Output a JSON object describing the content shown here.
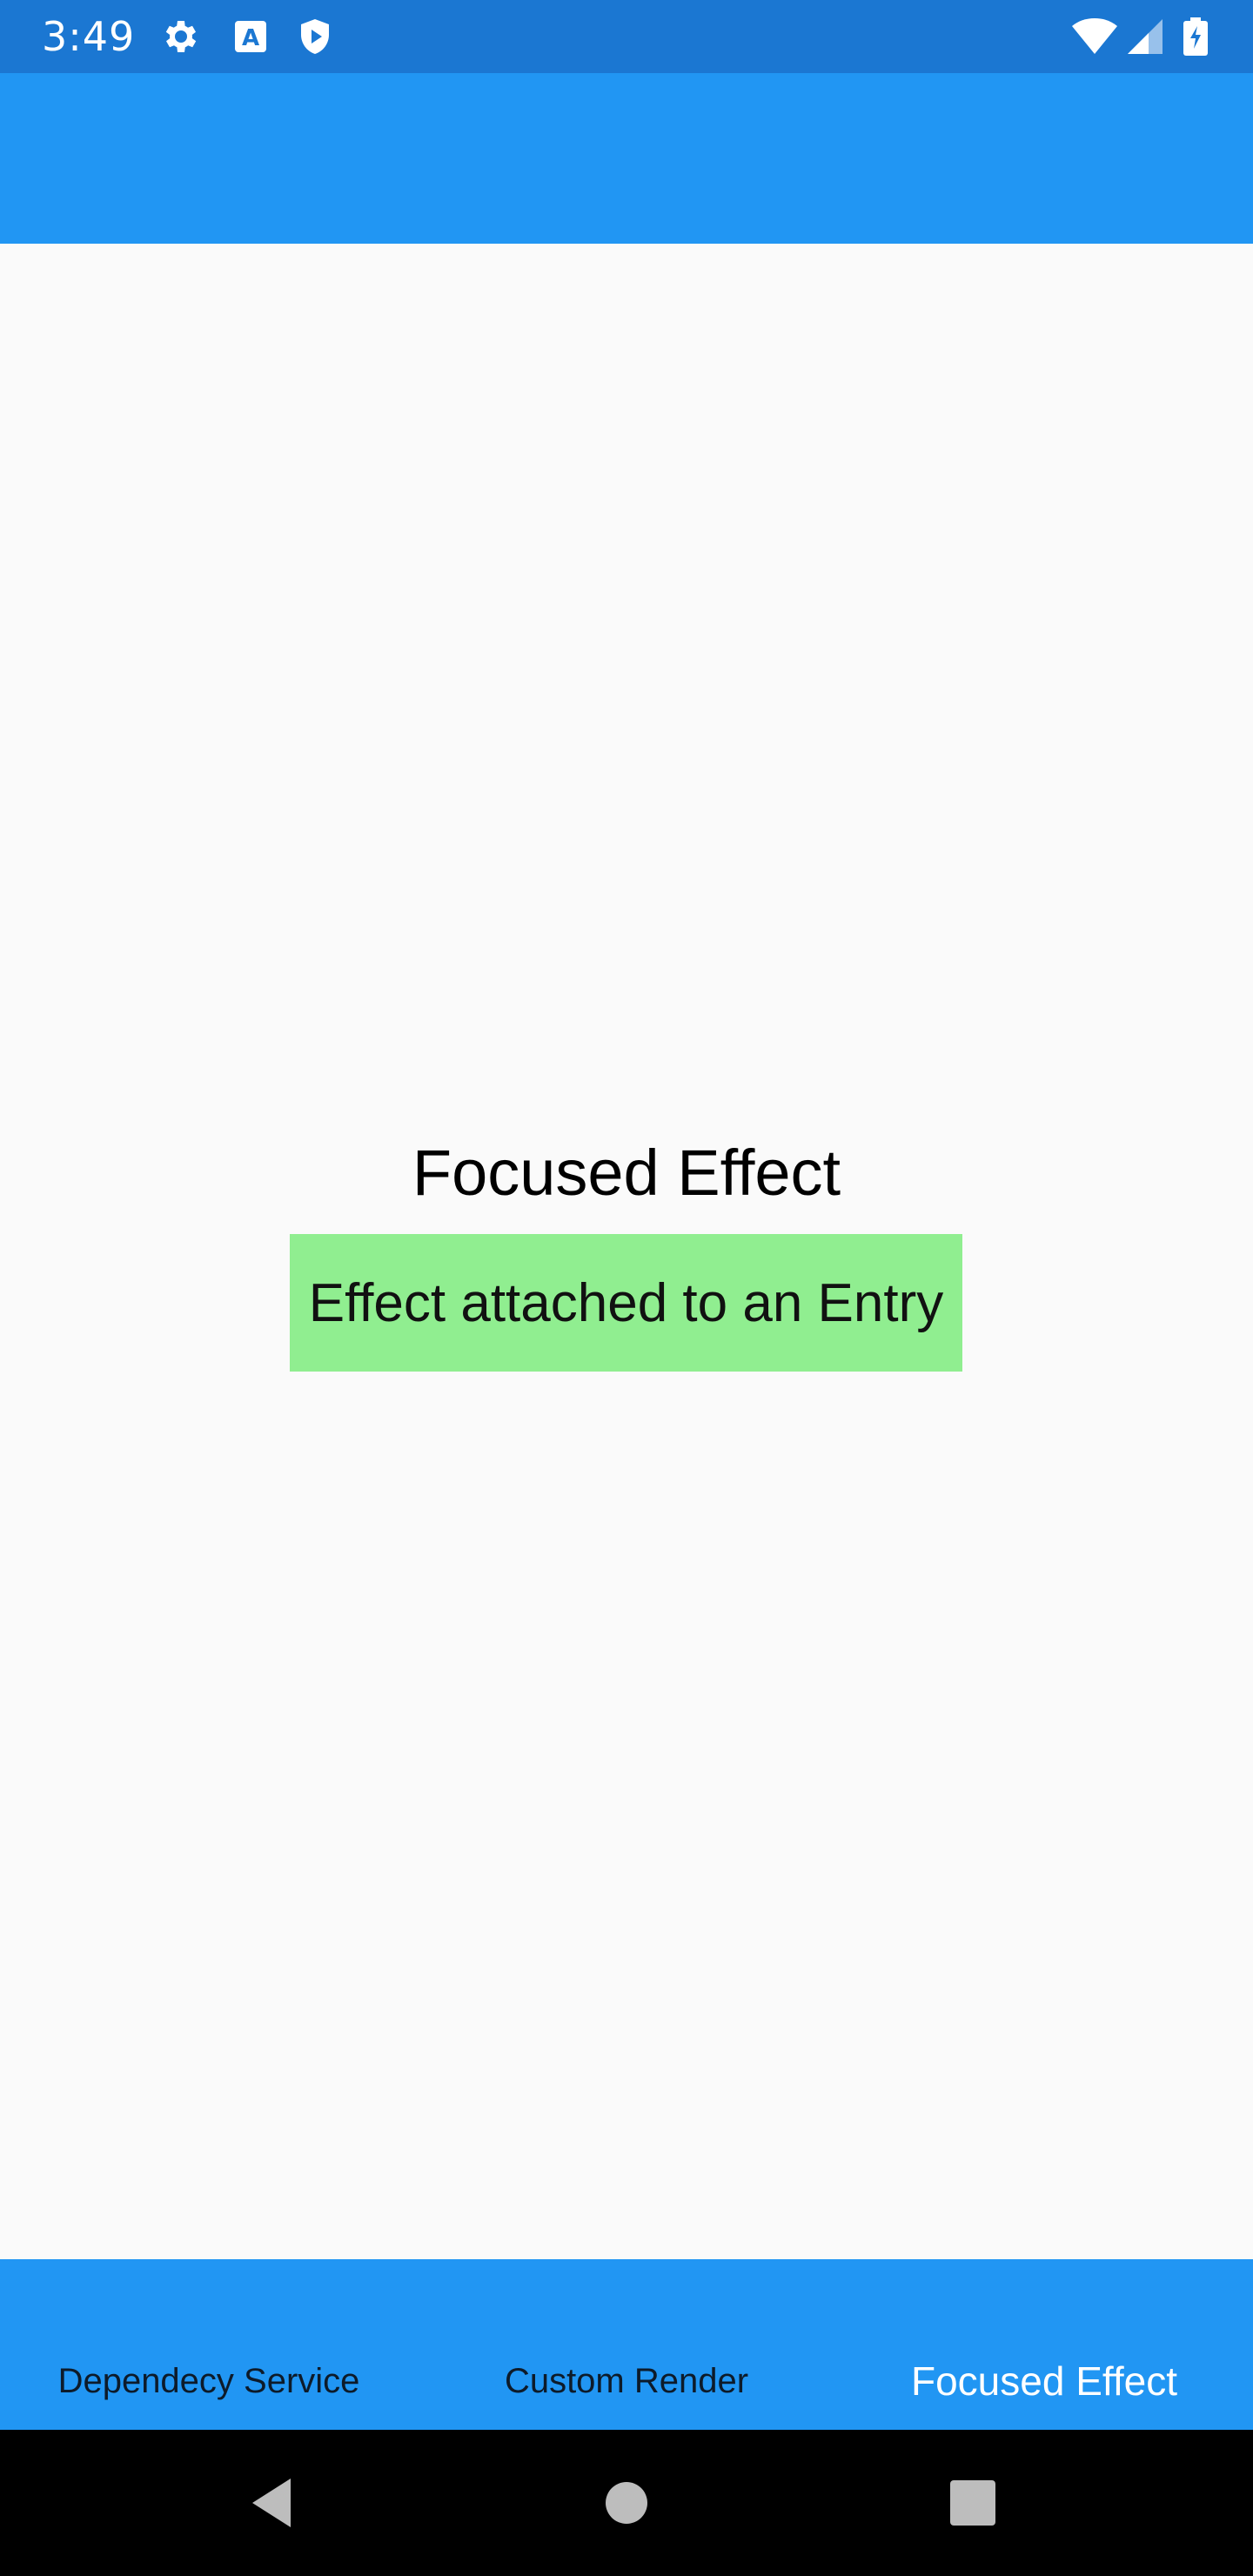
{
  "status_bar": {
    "time": "3:49",
    "left_icons": [
      "gear-icon",
      "a-badge-icon",
      "shield-play-icon"
    ],
    "right_icons": [
      "wifi-icon",
      "cellular-icon",
      "battery-charging-icon"
    ],
    "background": "#1b77d2"
  },
  "app_bar": {
    "background": "#2196f3"
  },
  "main": {
    "title": "Focused Effect",
    "entry": {
      "value": "Effect attached to an Entry",
      "background": "#90ee90"
    }
  },
  "tabs": [
    {
      "label": "Dependecy Service",
      "active": false
    },
    {
      "label": "Custom Render",
      "active": false
    },
    {
      "label": "Focused Effect",
      "active": true
    }
  ],
  "nav_bar": {
    "buttons": [
      "back-icon",
      "home-icon",
      "recents-icon"
    ]
  }
}
